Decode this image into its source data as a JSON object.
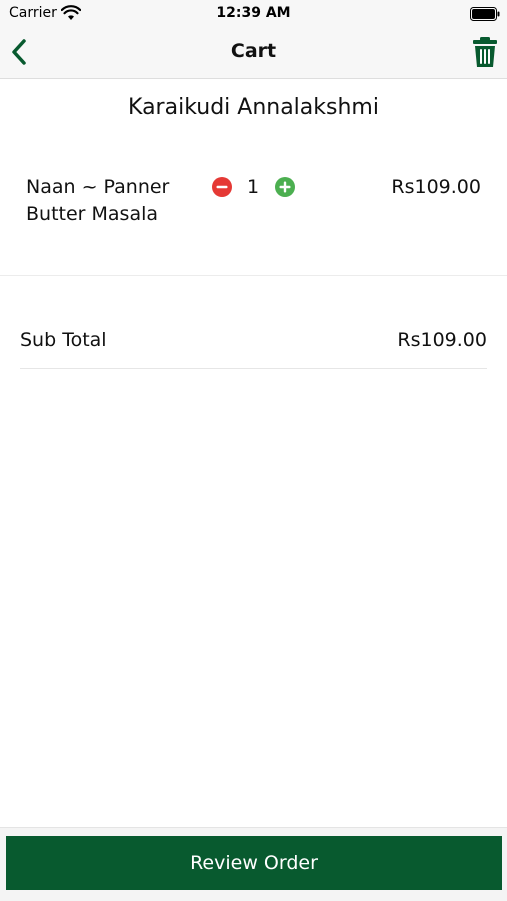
{
  "status_bar": {
    "carrier": "Carrier",
    "time": "12:39 AM"
  },
  "nav": {
    "title": "Cart",
    "back_icon": "chevron-left-icon",
    "trash_icon": "trash-icon"
  },
  "restaurant_name": "Karaikudi Annalakshmi",
  "cart_items": [
    {
      "name": "Naan ~ Panner Butter Masala",
      "quantity": "1",
      "price": "Rs109.00"
    }
  ],
  "summary": {
    "subtotal_label": "Sub Total",
    "subtotal_value": "Rs109.00"
  },
  "footer": {
    "review_button_label": "Review Order"
  },
  "colors": {
    "accent": "#085a2f",
    "minus": "#e53935",
    "plus": "#4caf50",
    "background": "#ffffff"
  }
}
